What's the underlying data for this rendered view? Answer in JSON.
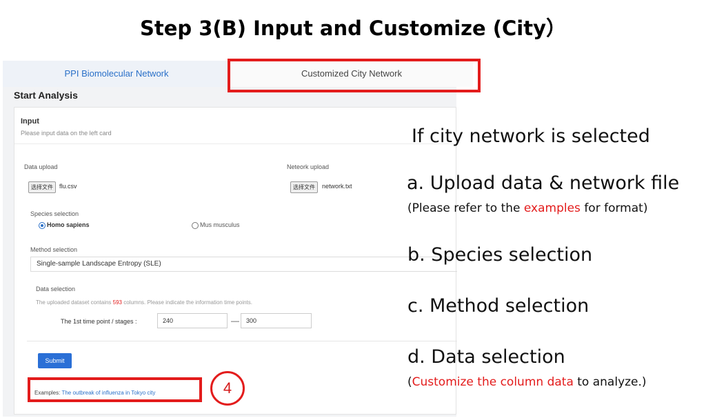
{
  "slide_title": "Step 3(B)  Input and Customize (City）",
  "tabs": [
    {
      "label": "PPI Biomolecular Network"
    },
    {
      "label": "Customized City Network"
    }
  ],
  "start_analysis": "Start Analysis",
  "card": {
    "title": "Input",
    "subtitle": "Please input data on the left card"
  },
  "data_upload": {
    "label": "Data upload",
    "button": "选择文件",
    "file": "flu.csv"
  },
  "network_upload": {
    "label": "Neteork upload",
    "button": "选择文件",
    "file": "network.txt"
  },
  "species": {
    "label": "Species selection",
    "options": [
      "Homo sapiens",
      "Mus musculus"
    ],
    "selected": "Homo sapiens"
  },
  "method": {
    "label": "Method selection",
    "value": "Single-sample Landscape Entropy (SLE)"
  },
  "data_selection": {
    "label": "Data selection",
    "note_pre": "The uploaded dataset contains ",
    "columns": "593",
    "note_post": " columns. Please indicate the information time points.",
    "timepoint_label": "The 1st time point / stages :",
    "from": "240",
    "to": "300",
    "dash": "—"
  },
  "submit_label": "Submit",
  "examples": {
    "prefix": "Examples: ",
    "link": "The outbreak of influenza in Tokyo city"
  },
  "step_number": "4",
  "annotations": {
    "heading": "If city network is selected",
    "a": "a. Upload data & network file",
    "a_note_pre": "(Please refer to the ",
    "a_note_red": "examples",
    "a_note_post": " for format)",
    "b": "b.  Species selection",
    "c": "c.  Method selection",
    "d": "d. Data selection",
    "d_note_pre": "(",
    "d_note_red": "Customize the column data",
    "d_note_post": " to analyze.)"
  },
  "colors": {
    "highlight_red": "#e31c1c",
    "link_blue": "#2a70c8",
    "button_blue": "#2a6fd6"
  }
}
